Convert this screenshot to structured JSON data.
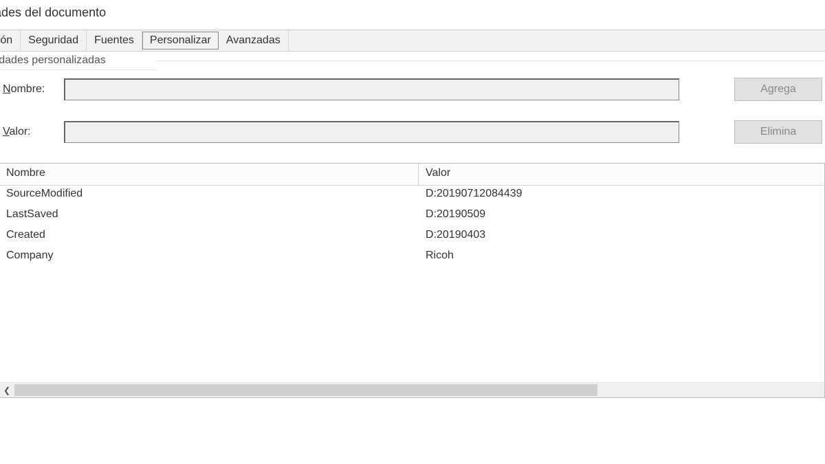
{
  "window": {
    "title": "iedades del documento"
  },
  "tabs": {
    "t0": "cripción",
    "t1": "Seguridad",
    "t2": "Fuentes",
    "t3": "Personalizar",
    "t4": "Avanzadas"
  },
  "panel": {
    "title": "opiedades personalizadas"
  },
  "form": {
    "name_label_pre": "N",
    "name_label_post": "ombre:",
    "value_label_pre": "V",
    "value_label_post": "alor:",
    "name_value": "",
    "value_value": "",
    "add_btn": "Agrega",
    "del_btn": "Elimina"
  },
  "table": {
    "col_name": "Nombre",
    "col_value": "Valor",
    "rows": [
      {
        "name": "SourceModified",
        "value": "D:20190712084439"
      },
      {
        "name": "LastSaved",
        "value": "D:20190509"
      },
      {
        "name": "Created",
        "value": "D:20190403"
      },
      {
        "name": "Company",
        "value": "Ricoh"
      }
    ]
  }
}
